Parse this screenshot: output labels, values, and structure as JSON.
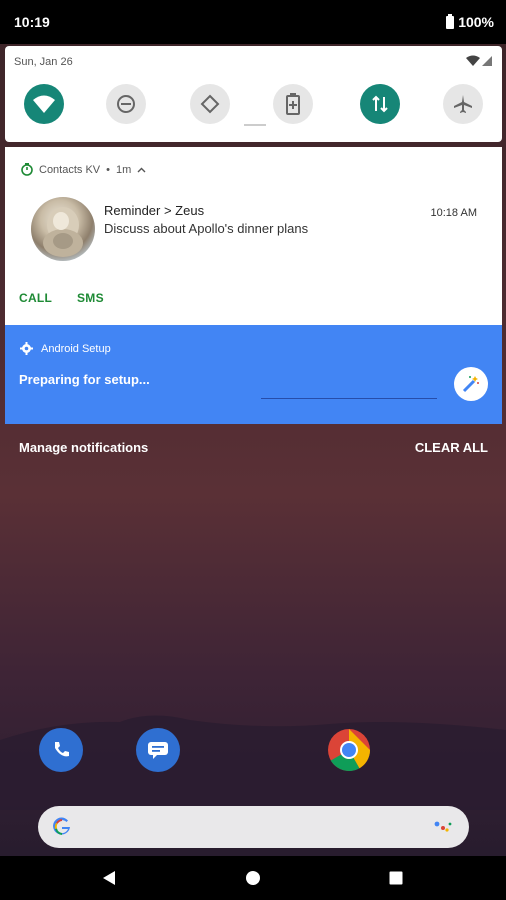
{
  "status_bar": {
    "time": "10:19",
    "battery": "100%"
  },
  "quick_settings": {
    "date": "Sun, Jan 26",
    "tiles": [
      {
        "name": "wifi",
        "active": true
      },
      {
        "name": "do-not-disturb",
        "active": false
      },
      {
        "name": "auto-rotate",
        "active": false
      },
      {
        "name": "battery-saver",
        "active": false
      },
      {
        "name": "mobile-data",
        "active": true
      },
      {
        "name": "airplane-mode",
        "active": false
      }
    ]
  },
  "notification": {
    "app_name": "Contacts KV",
    "separator": "•",
    "age": "1m",
    "title": "Reminder > Zeus",
    "text": "Discuss about Apollo's dinner plans",
    "time": "10:18 AM",
    "actions": {
      "call": "CALL",
      "sms": "SMS"
    }
  },
  "setup": {
    "app_name": "Android Setup",
    "text": "Preparing for setup..."
  },
  "footer": {
    "manage": "Manage notifications",
    "clear_all": "CLEAR ALL"
  },
  "colors": {
    "accent_teal": "#168677",
    "setup_blue": "#4285f4",
    "action_green": "#1e8a35"
  }
}
